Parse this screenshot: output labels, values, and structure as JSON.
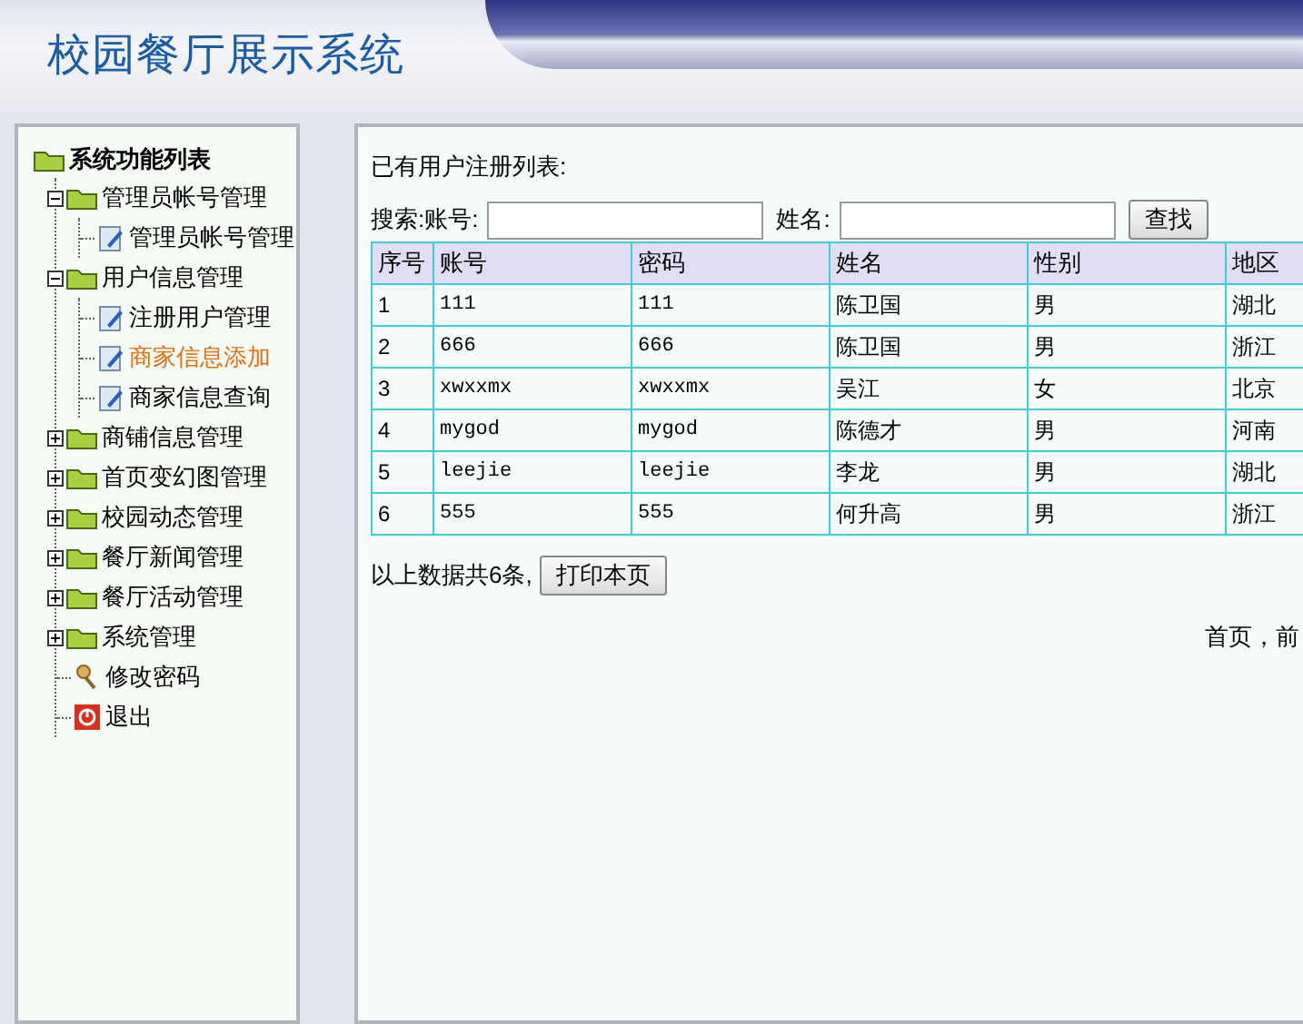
{
  "header": {
    "title": "校园餐厅展示系统"
  },
  "sidebar": {
    "title": "系统功能列表",
    "items": [
      {
        "kind": "folder",
        "label": "管理员帐号管理",
        "expanded": true,
        "children": [
          {
            "kind": "page",
            "label": "管理员帐号管理",
            "selected": false
          }
        ]
      },
      {
        "kind": "folder",
        "label": "用户信息管理",
        "expanded": true,
        "children": [
          {
            "kind": "page",
            "label": "注册用户管理",
            "selected": false
          },
          {
            "kind": "page",
            "label": "商家信息添加",
            "selected": true
          },
          {
            "kind": "page",
            "label": "商家信息查询",
            "selected": false
          }
        ]
      },
      {
        "kind": "folder",
        "label": "商铺信息管理",
        "expanded": false
      },
      {
        "kind": "folder",
        "label": "首页变幻图管理",
        "expanded": false
      },
      {
        "kind": "folder",
        "label": "校园动态管理",
        "expanded": false
      },
      {
        "kind": "folder",
        "label": "餐厅新闻管理",
        "expanded": false
      },
      {
        "kind": "folder",
        "label": "餐厅活动管理",
        "expanded": false
      },
      {
        "kind": "folder",
        "label": "系统管理",
        "expanded": false
      },
      {
        "kind": "key",
        "label": "修改密码"
      },
      {
        "kind": "exit",
        "label": "退出"
      }
    ]
  },
  "content": {
    "heading": "已有用户注册列表:",
    "search": {
      "label": "搜索:账号:",
      "name_label": "姓名:",
      "button": "查找"
    },
    "table": {
      "columns": [
        "序号",
        "账号",
        "密码",
        "姓名",
        "性别",
        "地区"
      ],
      "rows": [
        [
          "1",
          "111",
          "111",
          "陈卫国",
          "男",
          "湖北"
        ],
        [
          "2",
          "666",
          "666",
          "陈卫国",
          "男",
          "浙江"
        ],
        [
          "3",
          "xwxxmx",
          "xwxxmx",
          "吴江",
          "女",
          "北京"
        ],
        [
          "4",
          "mygod",
          "mygod",
          "陈德才",
          "男",
          "河南"
        ],
        [
          "5",
          "leejie",
          "leejie",
          "李龙",
          "男",
          "湖北"
        ],
        [
          "6",
          "555",
          "555",
          "何升高",
          "男",
          "浙江"
        ]
      ]
    },
    "summary": "以上数据共6条,",
    "print_button": "打印本页",
    "pager": "首页，前"
  }
}
